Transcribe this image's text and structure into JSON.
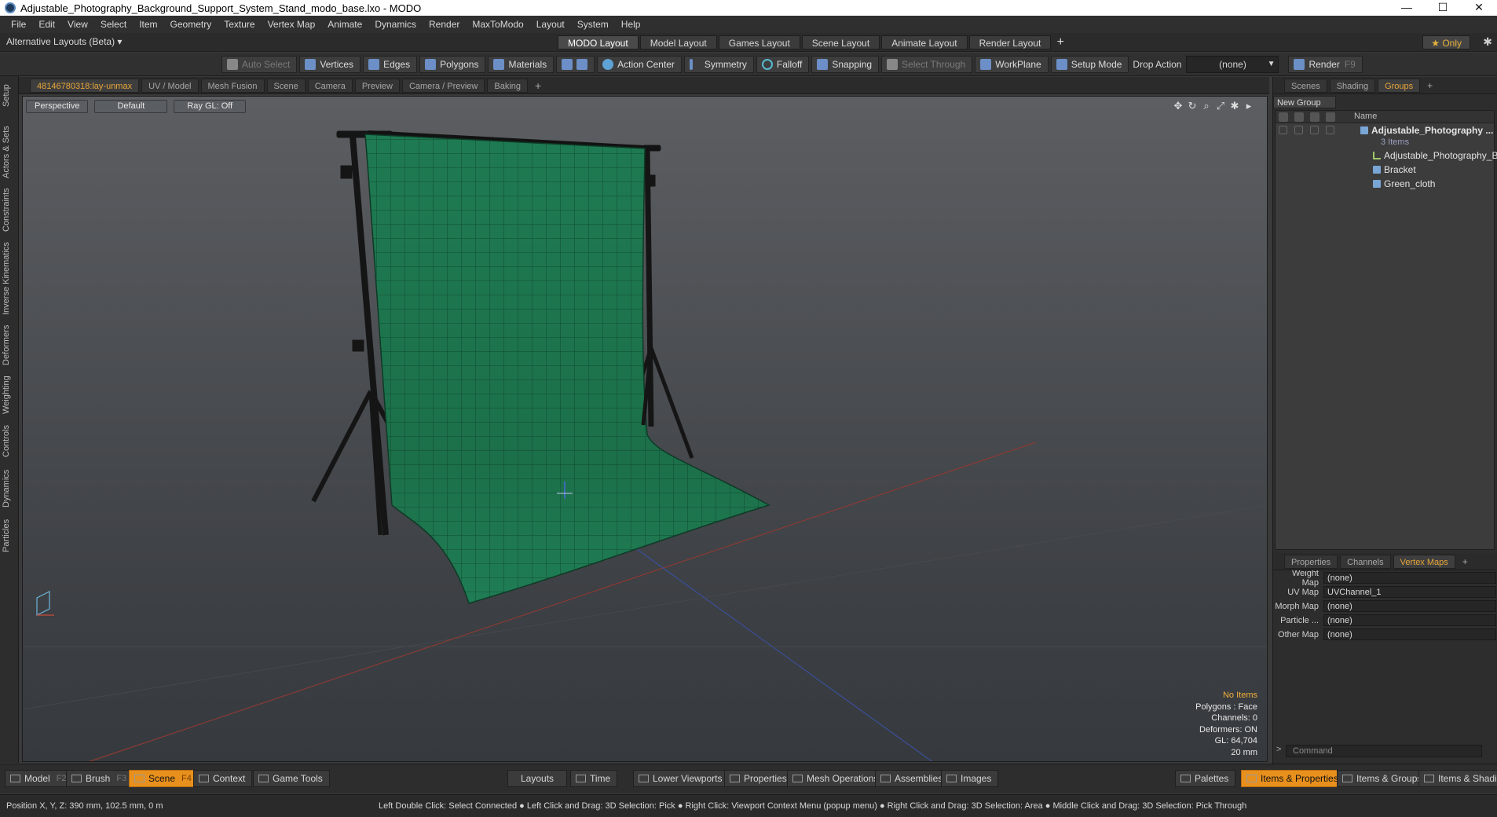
{
  "window": {
    "title": "Adjustable_Photography_Background_Support_System_Stand_modo_base.lxo - MODO",
    "minimize": "—",
    "maximize": "☐",
    "close": "✕"
  },
  "menu": [
    "File",
    "Edit",
    "View",
    "Select",
    "Item",
    "Geometry",
    "Texture",
    "Vertex Map",
    "Animate",
    "Dynamics",
    "Render",
    "MaxToModo",
    "Layout",
    "System",
    "Help"
  ],
  "layoutbar": {
    "alt_layouts": "Alternative Layouts (Beta) ▾",
    "tabs": [
      "MODO Layout",
      "Model Layout",
      "Games Layout",
      "Scene Layout",
      "Animate Layout",
      "Render Layout"
    ],
    "active_tab": "MODO Layout",
    "add": "+",
    "only": "★ Only",
    "gear": "✱"
  },
  "toolbar": {
    "auto_select": "Auto Select",
    "vertices": "Vertices",
    "edges": "Edges",
    "polygons": "Polygons",
    "materials": "Materials",
    "action_center": "Action Center",
    "symmetry": "Symmetry",
    "falloff": "Falloff",
    "snapping": "Snapping",
    "select_through": "Select Through",
    "workplane": "WorkPlane",
    "setup_mode": "Setup Mode",
    "drop_action_label": "Drop Action",
    "drop_action_value": "(none)",
    "render": "Render",
    "render_key": "F9"
  },
  "left_tabs": [
    "Setup",
    "Actors & Sets",
    "Constraints",
    "Inverse Kinematics",
    "Deformers",
    "Weighting",
    "Controls",
    "Dynamics",
    "Particles"
  ],
  "viewport_tabs": [
    "48146780318:lay-unmax",
    "UV / Model",
    "Mesh Fusion",
    "Scene",
    "Camera",
    "Preview",
    "Camera / Preview",
    "Baking"
  ],
  "viewport_tabs_add": "+",
  "viewport": {
    "view_mode": "Perspective",
    "shading": "Default",
    "raygl": "Ray GL: Off",
    "stats": {
      "items": "No Items",
      "polygons": "Polygons : Face",
      "channels": "Channels: 0",
      "deformers": "Deformers: ON",
      "gl": "GL: 64,704",
      "grid": "20 mm"
    }
  },
  "right_panel": {
    "tabs": [
      "Scenes",
      "Shading",
      "Groups"
    ],
    "active_tab": "Groups",
    "add": "+",
    "new_group": "New Group",
    "col_name": "Name",
    "group_name": "Adjustable_Photography ...",
    "group_count": "3 Items",
    "items": [
      "Adjustable_Photography_B...",
      "Bracket",
      "Green_cloth"
    ]
  },
  "vertex_panel": {
    "tabs": [
      "Properties",
      "Channels",
      "Vertex Maps"
    ],
    "active_tab": "Vertex Maps",
    "add": "+",
    "rows": [
      {
        "label": "Weight Map",
        "value": "(none)"
      },
      {
        "label": "UV Map",
        "value": "UVChannel_1"
      },
      {
        "label": "Morph Map",
        "value": "(none)"
      },
      {
        "label": "Particle ...",
        "value": "(none)"
      },
      {
        "label": "Other Map",
        "value": "(none)"
      }
    ],
    "command_placeholder": "Command"
  },
  "bottom": {
    "model": "Model",
    "model_key": "F2",
    "brush": "Brush",
    "brush_key": "F3",
    "scene": "Scene",
    "scene_key": "F4",
    "context": "Context",
    "game_tools": "Game Tools",
    "layouts": "Layouts",
    "time": "Time",
    "lower_viewports": "Lower Viewports",
    "properties": "Properties",
    "mesh_operations": "Mesh Operations",
    "assemblies": "Assemblies",
    "images": "Images",
    "palettes": "Palettes",
    "items_properties": "Items & Properties",
    "items_groups": "Items & Groups",
    "items_shading": "Items & Shading"
  },
  "status": {
    "position": "Position X, Y, Z:   390 mm, 102.5 mm, 0 m",
    "hints": "Left Double Click: Select Connected ● Left Click and Drag: 3D Selection: Pick ● Right Click: Viewport Context Menu (popup menu) ● Right Click and Drag: 3D Selection: Area ● Middle Click and Drag: 3D Selection: Pick Through"
  },
  "colors": {
    "accent_orange": "#e8901d",
    "cloth_green": "#1f7a52",
    "stand_black": "#151515"
  }
}
